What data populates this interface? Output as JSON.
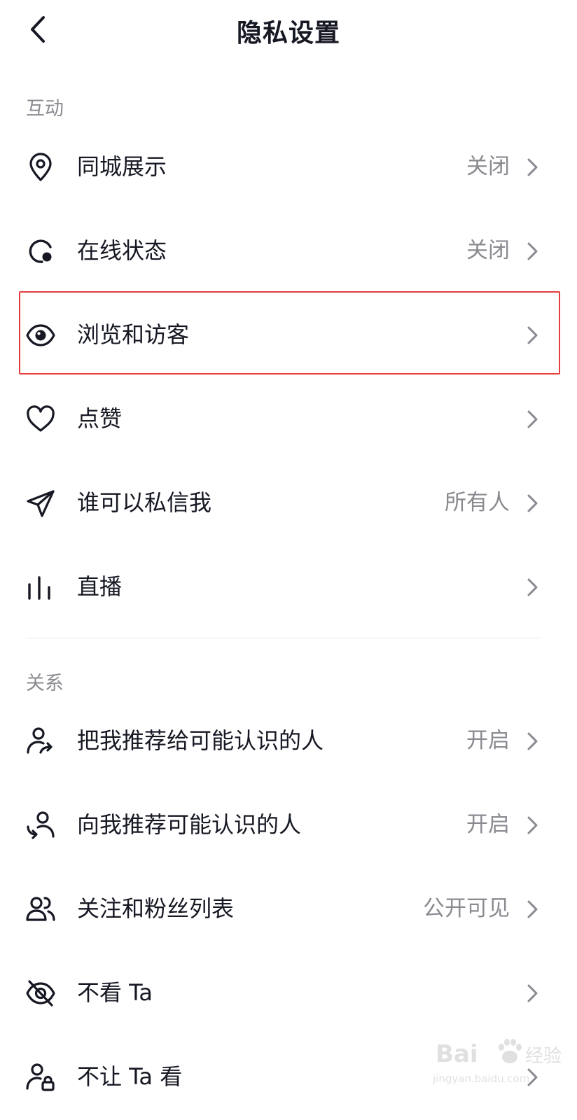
{
  "header": {
    "title": "隐私设置"
  },
  "sections": [
    {
      "label": "互动"
    },
    {
      "label": "关系"
    }
  ],
  "rows": [
    {
      "label": "同城展示",
      "value": "关闭",
      "icon": "location-pin-icon"
    },
    {
      "label": "在线状态",
      "value": "关闭",
      "icon": "online-status-icon"
    },
    {
      "label": "浏览和访客",
      "value": "",
      "icon": "eye-icon"
    },
    {
      "label": "点赞",
      "value": "",
      "icon": "heart-icon"
    },
    {
      "label": "谁可以私信我",
      "value": "所有人",
      "icon": "paper-plane-icon"
    },
    {
      "label": "直播",
      "value": "",
      "icon": "live-bars-icon"
    },
    {
      "label": "把我推荐给可能认识的人",
      "value": "开启",
      "icon": "user-share-icon"
    },
    {
      "label": "向我推荐可能认识的人",
      "value": "开启",
      "icon": "user-recommend-icon"
    },
    {
      "label": "关注和粉丝列表",
      "value": "公开可见",
      "icon": "users-icon"
    },
    {
      "label": "不看 Ta",
      "value": "",
      "icon": "eye-off-icon"
    },
    {
      "label": "不让 Ta 看",
      "value": "",
      "icon": "user-lock-icon"
    }
  ],
  "watermark": {
    "logo": "Bai",
    "cn": "经验",
    "url": "jingyan.baidu.com"
  },
  "colors": {
    "highlight": "#e53d3d",
    "text": "#161823",
    "secondary": "#8a8b91"
  }
}
